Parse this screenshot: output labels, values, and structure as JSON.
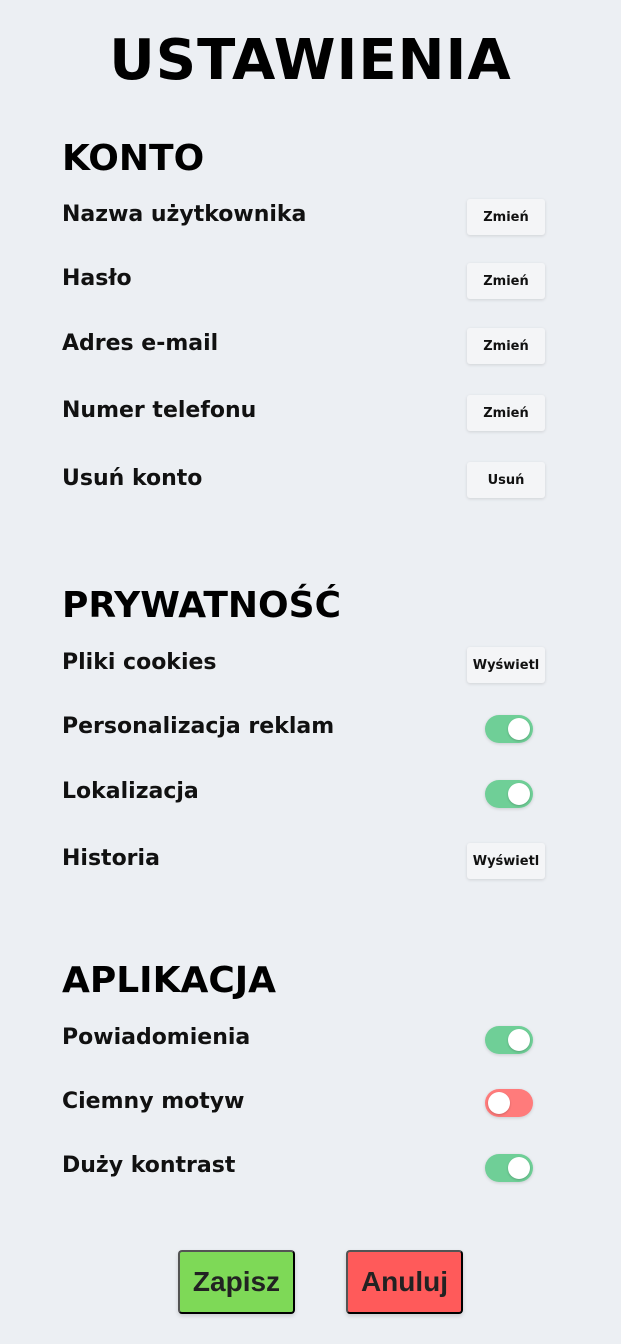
{
  "title": "USTAWIENIA",
  "colors": {
    "background": "#eceff3",
    "toggle_on": "#6fcf97",
    "toggle_off": "#ff7b7b",
    "save": "#7ed957",
    "cancel": "#ff5a5a"
  },
  "sections": {
    "konto": {
      "title": "KONTO",
      "rows": [
        {
          "label": "Nazwa użytkownika",
          "button": "Zmień"
        },
        {
          "label": "Hasło",
          "button": "Zmień"
        },
        {
          "label": "Adres e-mail",
          "button": "Zmień"
        },
        {
          "label": "Numer telefonu",
          "button": "Zmień"
        },
        {
          "label": "Usuń konto",
          "button": "Usuń"
        }
      ]
    },
    "prywatnosc": {
      "title": "PRYWATNOŚĆ",
      "rows": [
        {
          "label": "Pliki cookies",
          "button": "Wyświetl"
        },
        {
          "label": "Personalizacja reklam",
          "toggle": "on"
        },
        {
          "label": "Lokalizacja",
          "toggle": "on"
        },
        {
          "label": "Historia",
          "button": "Wyświetl"
        }
      ]
    },
    "aplikacja": {
      "title": "APLIKACJA",
      "rows": [
        {
          "label": "Powiadomienia",
          "toggle": "on"
        },
        {
          "label": "Ciemny motyw",
          "toggle": "off"
        },
        {
          "label": "Duży kontrast",
          "toggle": "on"
        }
      ]
    }
  },
  "actions": {
    "save": "Zapisz",
    "cancel": "Anuluj"
  }
}
